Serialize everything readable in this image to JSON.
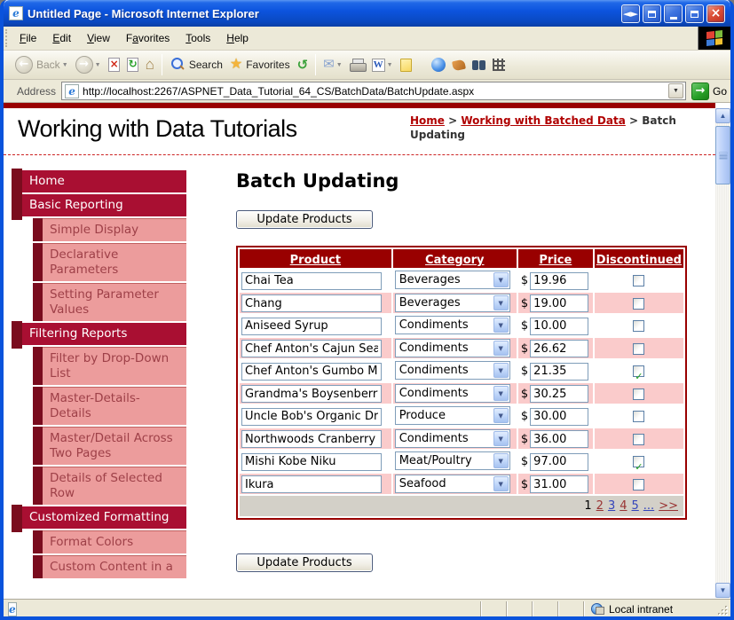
{
  "window": {
    "title": "Untitled Page - Microsoft Internet Explorer"
  },
  "menu": {
    "items": [
      "File",
      "Edit",
      "View",
      "Favorites",
      "Tools",
      "Help"
    ]
  },
  "toolbar": {
    "back_label": "Back",
    "search_label": "Search",
    "favorites_label": "Favorites"
  },
  "address": {
    "label": "Address",
    "url": "http://localhost:2267/ASPNET_Data_Tutorial_64_CS/BatchData/BatchUpdate.aspx",
    "go_label": "Go"
  },
  "header": {
    "site_title": "Working with Data Tutorials",
    "breadcrumb": {
      "home": "Home",
      "sep1": " > ",
      "section": "Working with Batched Data",
      "sep2": " > ",
      "current": "Batch Updating"
    }
  },
  "sidebar": {
    "items": [
      {
        "label": "Home",
        "type": "header"
      },
      {
        "label": "Basic Reporting",
        "type": "header"
      },
      {
        "label": "Simple Display",
        "type": "item"
      },
      {
        "label": "Declarative Parameters",
        "type": "item"
      },
      {
        "label": "Setting Parameter Values",
        "type": "item"
      },
      {
        "label": "Filtering Reports",
        "type": "header"
      },
      {
        "label": "Filter by Drop-Down List",
        "type": "item"
      },
      {
        "label": "Master-Details-Details",
        "type": "item"
      },
      {
        "label": "Master/Detail Across Two Pages",
        "type": "item"
      },
      {
        "label": "Details of Selected Row",
        "type": "item"
      },
      {
        "label": "Customized Formatting",
        "type": "header"
      },
      {
        "label": "Format Colors",
        "type": "item"
      },
      {
        "label": "Custom Content in a",
        "type": "item"
      }
    ]
  },
  "main": {
    "heading": "Batch Updating",
    "update_button": "Update Products",
    "table": {
      "columns": [
        "Product",
        "Category",
        "Price",
        "Discontinued"
      ],
      "currency": "$",
      "rows": [
        {
          "product": "Chai Tea",
          "category": "Beverages",
          "price": "19.96",
          "discontinued": false
        },
        {
          "product": "Chang",
          "category": "Beverages",
          "price": "19.00",
          "discontinued": false
        },
        {
          "product": "Aniseed Syrup",
          "category": "Condiments",
          "price": "10.00",
          "discontinued": false
        },
        {
          "product": "Chef Anton's Cajun Sea",
          "category": "Condiments",
          "price": "26.62",
          "discontinued": false
        },
        {
          "product": "Chef Anton's Gumbo Mi",
          "category": "Condiments",
          "price": "21.35",
          "discontinued": true
        },
        {
          "product": "Grandma's Boysenberry",
          "category": "Condiments",
          "price": "30.25",
          "discontinued": false
        },
        {
          "product": "Uncle Bob's Organic Dri",
          "category": "Produce",
          "price": "30.00",
          "discontinued": false
        },
        {
          "product": "Northwoods Cranberry",
          "category": "Condiments",
          "price": "36.00",
          "discontinued": false
        },
        {
          "product": "Mishi Kobe Niku",
          "category": "Meat/Poultry",
          "price": "97.00",
          "discontinued": true
        },
        {
          "product": "Ikura",
          "category": "Seafood",
          "price": "31.00",
          "discontinued": false
        }
      ],
      "pager": {
        "items": [
          {
            "label": "1",
            "state": "current"
          },
          {
            "label": "2",
            "state": "visited"
          },
          {
            "label": "3",
            "state": "unvisited"
          },
          {
            "label": "4",
            "state": "visited"
          },
          {
            "label": "5",
            "state": "unvisited"
          },
          {
            "label": "...",
            "state": "unvisited"
          },
          {
            "label": ">>",
            "state": "visited"
          }
        ]
      }
    }
  },
  "status": {
    "zone": "Local intranet"
  },
  "colors": {
    "titlebar_blue": "#0C54DE",
    "chrome_beige": "#ECE9D8",
    "dark_red": "#990000",
    "sidebar_header_bg": "#A90F32",
    "sidebar_accent": "#7A0C1E",
    "sidebar_item_bg": "#EC9C9C",
    "sidebar_item_text": "#9E4048",
    "row_pink": "#FACBCB",
    "pager_bg": "#D3D0C8",
    "link_red": "#993333",
    "link_blue": "#3344BB",
    "breadcrumb_link": "#B00000"
  }
}
